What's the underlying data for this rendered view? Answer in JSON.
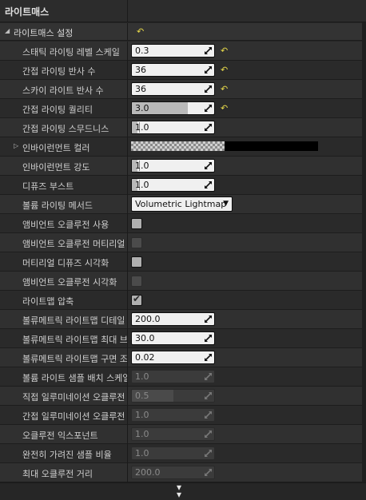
{
  "header": {
    "title": "라이트매스"
  },
  "section": {
    "title": "라이트매스 설정",
    "reset_icon": "reset-arrow-icon"
  },
  "rows": [
    {
      "type": "number",
      "label": "스태틱 라이팅 레벨 스케일",
      "value": "0.3",
      "reset": true,
      "disabled": false
    },
    {
      "type": "number",
      "label": "간접 라이팅 반사 수",
      "value": "36",
      "reset": true,
      "disabled": false
    },
    {
      "type": "number",
      "label": "스카이 라이트 반사 수",
      "value": "36",
      "reset": true,
      "disabled": false
    },
    {
      "type": "slider",
      "label": "간접 라이팅 퀄리티",
      "value": "3.0",
      "reset": true,
      "disabled": false,
      "level": 0.68
    },
    {
      "type": "slider",
      "label": "간접 라이팅 스무드니스",
      "value": "1.0",
      "reset": false,
      "disabled": false,
      "level": 0.07
    },
    {
      "type": "color",
      "label": "인바이런먼트 컬러",
      "expander": true
    },
    {
      "type": "slider",
      "label": "인바이런먼트 강도",
      "value": "1.0",
      "reset": false,
      "disabled": false,
      "level": 0.07
    },
    {
      "type": "slider",
      "label": "디퓨즈 부스트",
      "value": "1.0",
      "reset": false,
      "disabled": false,
      "level": 0.07
    },
    {
      "type": "dropdown",
      "label": "볼륨 라이팅 메서드",
      "value": "Volumetric Lightmap"
    },
    {
      "type": "checkbox",
      "label": "앰비언트 오클루전 사용",
      "checked": false,
      "disabled": false
    },
    {
      "type": "checkbox",
      "label": "앰비언트 오클루전 머티리얼 마스크",
      "checked": false,
      "disabled": true
    },
    {
      "type": "checkbox",
      "label": "머티리얼 디퓨즈 시각화",
      "checked": false,
      "disabled": false
    },
    {
      "type": "checkbox",
      "label": "앰비언트 오클루전 시각화",
      "checked": false,
      "disabled": true
    },
    {
      "type": "checkbox",
      "label": "라이트맵 압축",
      "checked": true,
      "disabled": false
    },
    {
      "type": "number",
      "label": "볼류메트릭 라이트맵 디테일 셀 크기",
      "value": "200.0",
      "reset": false,
      "disabled": false
    },
    {
      "type": "number",
      "label": "볼류메트릭 라이트맵 최대 브릭 메모리",
      "value": "30.0",
      "reset": false,
      "disabled": false
    },
    {
      "type": "number",
      "label": "볼류메트릭 라이트맵 구면 조화 스무딩",
      "value": "0.02",
      "reset": false,
      "disabled": false
    },
    {
      "type": "number",
      "label": "볼륨 라이트 샘플 배치 스케일",
      "value": "1.0",
      "reset": false,
      "disabled": true
    },
    {
      "type": "slider",
      "label": "직접 일루미네이션 오클루전 비율",
      "value": "0.5",
      "reset": false,
      "disabled": true,
      "level": 0.5
    },
    {
      "type": "number",
      "label": "간접 일루미네이션 오클루전 비율",
      "value": "1.0",
      "reset": false,
      "disabled": true
    },
    {
      "type": "number",
      "label": "오클루전 익스포넌트",
      "value": "1.0",
      "reset": false,
      "disabled": true
    },
    {
      "type": "number",
      "label": "완전히 가려진 샘플 비율",
      "value": "1.0",
      "reset": false,
      "disabled": true
    },
    {
      "type": "number",
      "label": "최대 오클루전 거리",
      "value": "200.0",
      "reset": false,
      "disabled": true
    }
  ],
  "footer": {
    "icon": "expand-down-icon"
  }
}
